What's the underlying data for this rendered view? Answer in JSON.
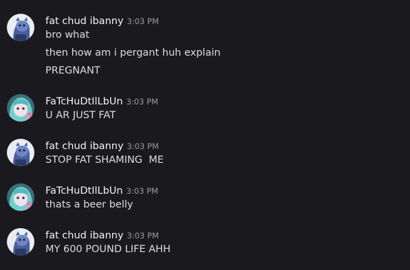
{
  "colors": {
    "background": "#1a1a1e",
    "username": "#f2f3f5",
    "timestamp": "#949ba4",
    "message_text": "#dbdee1"
  },
  "messages": [
    {
      "author": "fat chud ibanny",
      "avatar": "blue-character-avatar",
      "time": "3:03 PM",
      "lines": [
        "bro what",
        "then how am i pergant huh explain",
        "PREGNANT"
      ]
    },
    {
      "author": "FaTcHuDtIlLbUn",
      "avatar": "teal-haired-character-avatar",
      "time": "3:03 PM",
      "lines": [
        "U AR JUST FAT"
      ]
    },
    {
      "author": "fat chud ibanny",
      "avatar": "blue-character-avatar",
      "time": "3:03 PM",
      "lines": [
        "STOP FAT SHAMING  ME"
      ]
    },
    {
      "author": "FaTcHuDtIlLbUn",
      "avatar": "teal-haired-character-avatar",
      "time": "3:03 PM",
      "lines": [
        "thats a beer belly"
      ]
    },
    {
      "author": "fat chud ibanny",
      "avatar": "blue-character-avatar",
      "time": "3:03 PM",
      "lines": [
        "MY 600 POUND LIFE AHH"
      ]
    }
  ]
}
